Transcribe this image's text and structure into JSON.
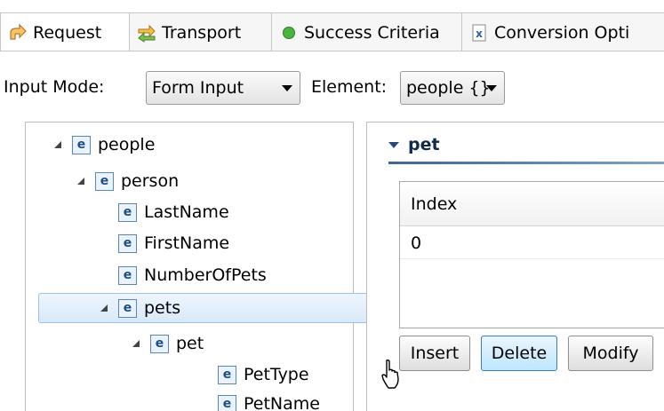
{
  "tabs": [
    {
      "label": "Request",
      "icon": "request-arrow-icon",
      "active": true
    },
    {
      "label": "Transport",
      "icon": "transport-icon",
      "active": false
    },
    {
      "label": "Success Criteria",
      "icon": "green-dot-icon",
      "active": false
    },
    {
      "label": "Conversion Opti",
      "icon": "conversion-x-icon",
      "active": false
    }
  ],
  "input_mode": {
    "label": "Input Mode:",
    "value": "Form Input"
  },
  "element": {
    "label": "Element:",
    "value": "people {}"
  },
  "tree": {
    "nodes": [
      {
        "label": "people",
        "expanded": true
      },
      {
        "label": "person",
        "expanded": true
      },
      {
        "label": "LastName"
      },
      {
        "label": "FirstName"
      },
      {
        "label": "NumberOfPets"
      },
      {
        "label": "pets",
        "expanded": true,
        "selected": true
      },
      {
        "label": "pet",
        "expanded": true
      },
      {
        "label": "PetType"
      },
      {
        "label": "PetName"
      }
    ]
  },
  "section": {
    "title": "pet"
  },
  "table": {
    "header": "Index",
    "rows": [
      "0"
    ]
  },
  "buttons": {
    "insert": "Insert",
    "delete": "Delete",
    "modify": "Modify"
  },
  "colors": {
    "selection": "#d9e9f9",
    "section_line": "#3d6599",
    "button_hover": "#bee6fd"
  }
}
